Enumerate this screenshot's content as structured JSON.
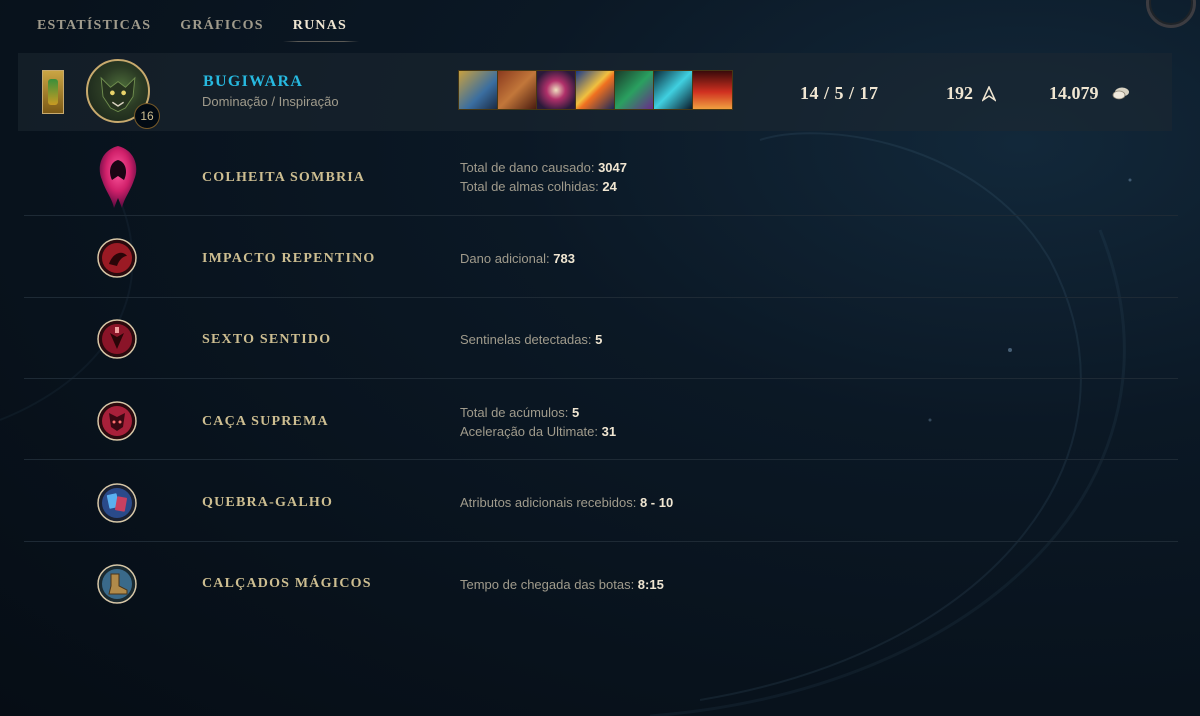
{
  "tabs": [
    {
      "label": "ESTATÍSTICAS",
      "active": false
    },
    {
      "label": "GRÁFICOS",
      "active": false
    },
    {
      "label": "RUNAS",
      "active": true
    }
  ],
  "player": {
    "name": "BUGIWARA",
    "rune_paths": "Dominação / Inspiração",
    "level": "16",
    "kda": "14 / 5 / 17",
    "cs": "192",
    "gold": "14.079",
    "items": [
      "boots-icon",
      "tome-icon",
      "orb-icon",
      "sword-icon",
      "cloak-icon",
      "blade-icon",
      "aura-icon"
    ]
  },
  "runes": [
    {
      "name": "COLHEITA SOMBRIA",
      "icon": "dark-harvest-icon",
      "stats": [
        {
          "label": "Total de dano causado: ",
          "value": "3047"
        },
        {
          "label": "Total de almas colhidas: ",
          "value": "24"
        }
      ]
    },
    {
      "name": "IMPACTO REPENTINO",
      "icon": "sudden-impact-icon",
      "stats": [
        {
          "label": "Dano adicional: ",
          "value": "783"
        }
      ]
    },
    {
      "name": "SEXTO SENTIDO",
      "icon": "sixth-sense-icon",
      "stats": [
        {
          "label": "Sentinelas detectadas: ",
          "value": "5"
        }
      ]
    },
    {
      "name": "CAÇA SUPREMA",
      "icon": "ultimate-hunter-icon",
      "stats": [
        {
          "label": "Total de acúmulos: ",
          "value": "5"
        },
        {
          "label": "Aceleração da Ultimate: ",
          "value": "31"
        }
      ]
    },
    {
      "name": "QUEBRA-GALHO",
      "icon": "jack-of-all-trades-icon",
      "stats": [
        {
          "label": "Atributos adicionais recebidos: ",
          "value": "8 - 10"
        }
      ]
    },
    {
      "name": "CALÇADOS MÁGICOS",
      "icon": "magical-footwear-icon",
      "stats": [
        {
          "label": "Tempo de chegada das botas: ",
          "value": "8:15"
        }
      ]
    }
  ],
  "colors": {
    "gold_text": "#cdbe91",
    "name_blue": "#27b9e0",
    "domination_red": "#c8283c"
  }
}
